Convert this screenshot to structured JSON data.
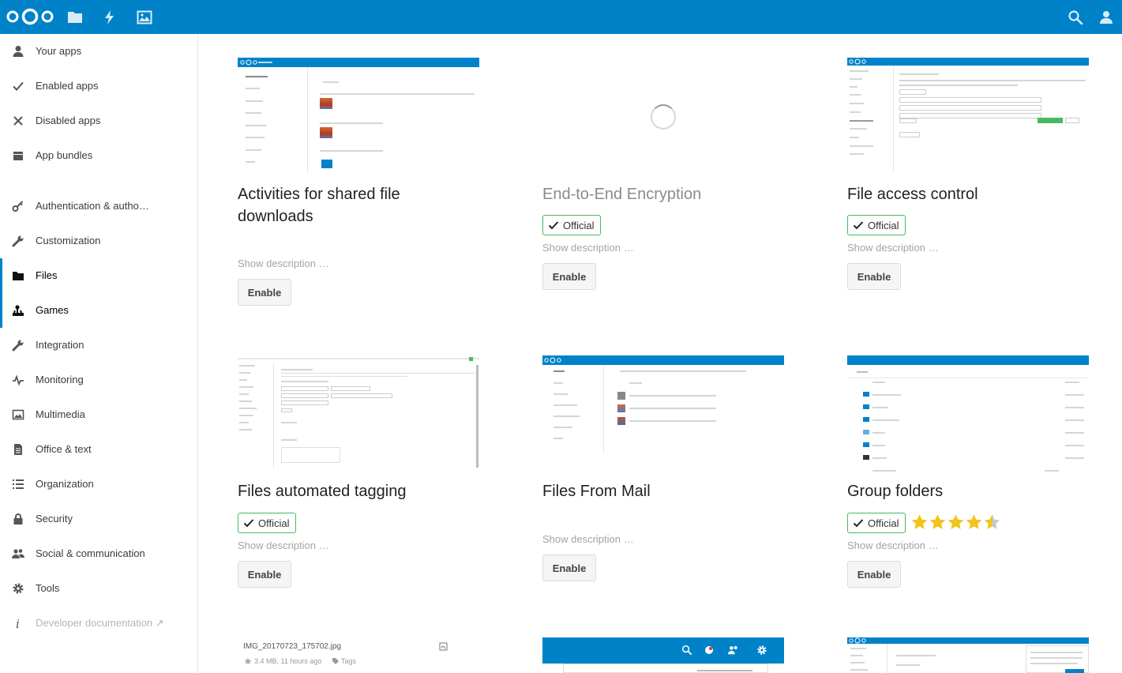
{
  "header": {
    "nav_icons": [
      "files-icon",
      "activity-icon",
      "gallery-icon"
    ],
    "right_icons": [
      "search-icon",
      "contacts-icon"
    ],
    "accent": "#0082c9"
  },
  "sidebar": {
    "items": [
      {
        "label": "Your apps",
        "icon": "user-icon"
      },
      {
        "label": "Enabled apps",
        "icon": "checkmark-icon"
      },
      {
        "label": "Disabled apps",
        "icon": "close-icon"
      },
      {
        "label": "App bundles",
        "icon": "bundle-icon"
      },
      {
        "label": "Authentication & autho…",
        "icon": "key-icon"
      },
      {
        "label": "Customization",
        "icon": "wrench-icon"
      },
      {
        "label": "Files",
        "icon": "folder-icon"
      },
      {
        "label": "Games",
        "icon": "joystick-icon"
      },
      {
        "label": "Integration",
        "icon": "wrench-icon"
      },
      {
        "label": "Monitoring",
        "icon": "pulse-icon"
      },
      {
        "label": "Multimedia",
        "icon": "picture-icon"
      },
      {
        "label": "Office & text",
        "icon": "document-icon"
      },
      {
        "label": "Organization",
        "icon": "list-icon"
      },
      {
        "label": "Security",
        "icon": "lock-icon"
      },
      {
        "label": "Social & communication",
        "icon": "people-icon"
      },
      {
        "label": "Tools",
        "icon": "gear-icon"
      },
      {
        "label": "Developer documentation ↗",
        "icon": "info-icon"
      }
    ]
  },
  "apps": [
    {
      "name": "Activities for shared file downloads",
      "name_line1": "Activities for shared file",
      "name_line2": "downloads",
      "official": false,
      "desc": "Show description …",
      "button": "Enable"
    },
    {
      "name": "End-to-End Encryption",
      "official": true,
      "official_label": "Official",
      "desc": "Show description …",
      "button": "Enable"
    },
    {
      "name": "File access control",
      "official": true,
      "official_label": "Official",
      "desc": "Show description …",
      "button": "Enable"
    },
    {
      "name": "Files automated tagging",
      "official": true,
      "official_label": "Official",
      "desc": "Show description …",
      "button": "Enable"
    },
    {
      "name": "Files From Mail",
      "official": false,
      "desc": "Show description …",
      "button": "Enable"
    },
    {
      "name": "Group folders",
      "official": true,
      "official_label": "Official",
      "rating": 4.5,
      "desc": "Show description …",
      "button": "Enable"
    }
  ],
  "bottom_row": {
    "file_name": "IMG_20170723_175702.jpg",
    "file_meta": "3.4 MB, 11 hours ago",
    "file_tags": "Tags"
  }
}
